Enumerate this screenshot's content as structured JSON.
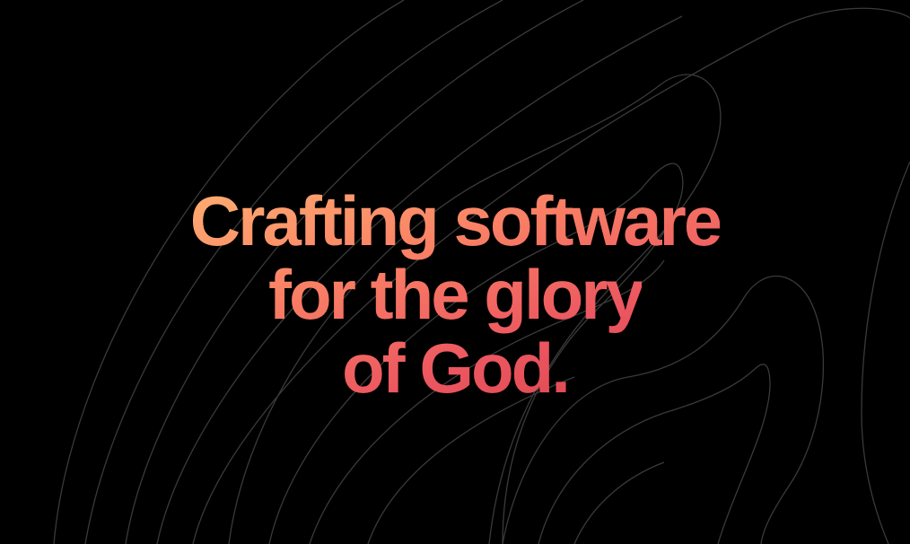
{
  "hero": {
    "headline_lines": [
      "Crafting software",
      "for the glory",
      "of God."
    ]
  },
  "colors": {
    "background": "#000000",
    "contour_stroke": "#3a3a3a",
    "gradient": [
      "#ffb071",
      "#f97f65",
      "#ec5660",
      "#d33e45"
    ]
  },
  "icons": {
    "background_art": "topographic-contour-lines"
  }
}
